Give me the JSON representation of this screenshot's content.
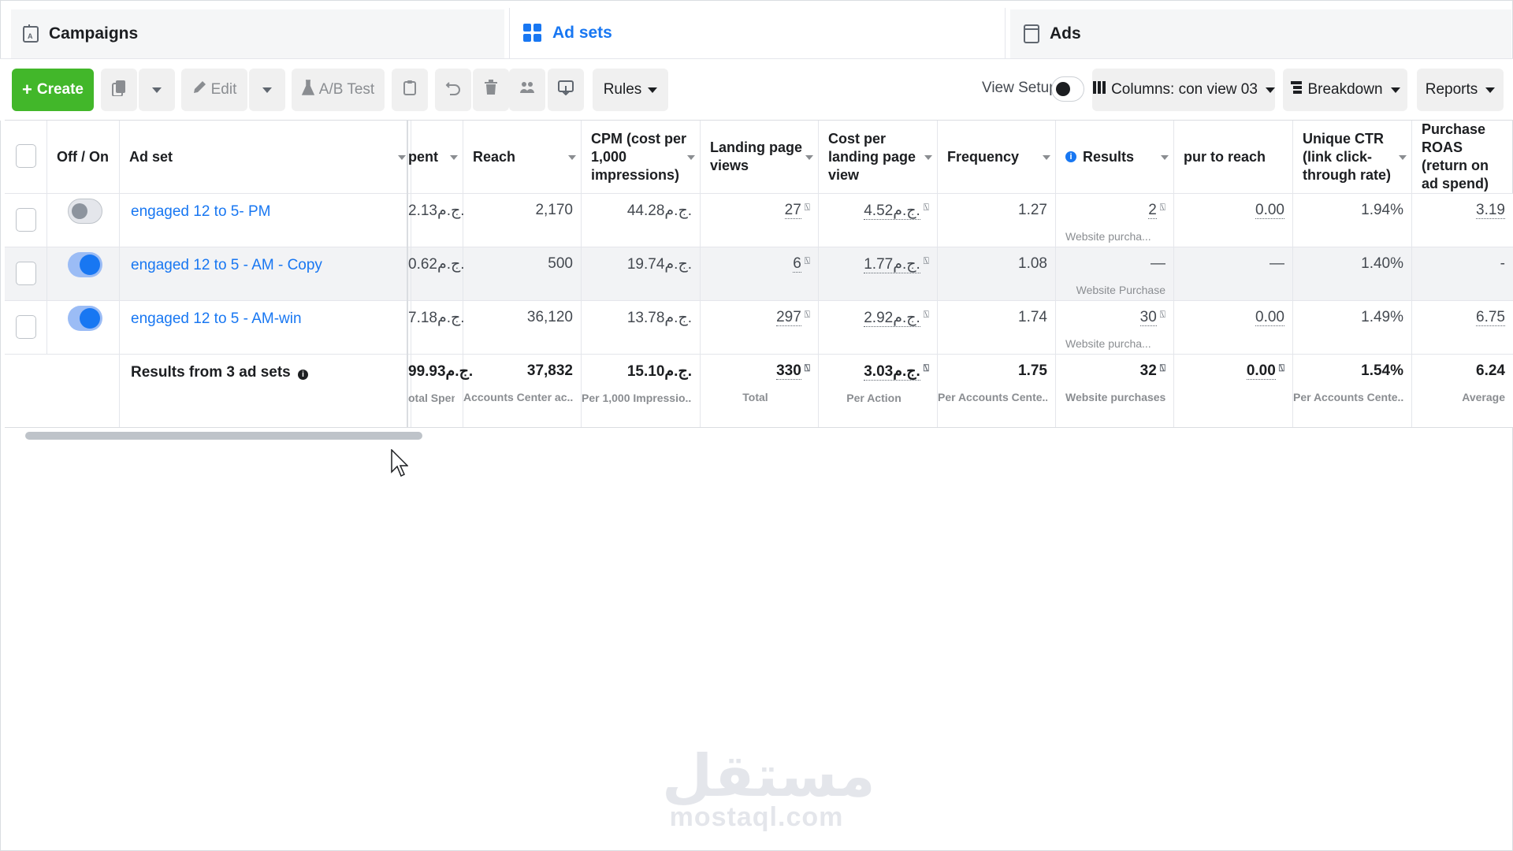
{
  "tabs": [
    {
      "label": "Campaigns",
      "icon": "campaign-flag-icon"
    },
    {
      "label": "Ad sets",
      "icon": "grid-icon",
      "active": true
    },
    {
      "label": "Ads",
      "icon": "ad-page-icon"
    }
  ],
  "toolbar": {
    "create_label": "Create",
    "edit_label": "Edit",
    "ab_test_label": "A/B Test",
    "rules_label": "Rules",
    "view_setup_label": "View Setup",
    "columns_label": "Columns: con view 03",
    "breakdown_label": "Breakdown",
    "reports_label": "Reports"
  },
  "table": {
    "headers": {
      "offon": "Off / On",
      "adset": "Ad set",
      "spent": "pent",
      "reach": "Reach",
      "cpm": "CPM (cost per 1,000 impressions)",
      "lpv": "Landing page views",
      "cplpv": "Cost per landing page view",
      "frequency": "Frequency",
      "results": "Results",
      "purreach": "pur to reach",
      "uctr": "Unique CTR (link click-through rate)",
      "roas": "Purchase ROAS (return on ad spend)"
    },
    "rows": [
      {
        "enabled": false,
        "name": "engaged 12 to 5- PM",
        "spent": "2.13ج.م.",
        "reach": "2,170",
        "cpm": "44.28ج.م.",
        "lpv": "27",
        "cplpv": "4.52ج.م.",
        "frequency": "1.27",
        "results": "2",
        "results_sub": "Website purcha...",
        "purreach": "0.00",
        "uctr": "1.94%",
        "roas": "3.19"
      },
      {
        "enabled": true,
        "name": "engaged 12 to 5 - AM - Copy",
        "spent": "0.62ج.م.",
        "reach": "500",
        "cpm": "19.74ج.م.",
        "lpv": "6",
        "cplpv": "1.77ج.م.",
        "frequency": "1.08",
        "results": "—",
        "results_sub": "Website Purchase",
        "purreach": "—",
        "uctr": "1.40%",
        "roas": "-"
      },
      {
        "enabled": true,
        "name": "engaged 12 to 5 - AM-win",
        "spent": "7.18ج.م.",
        "reach": "36,120",
        "cpm": "13.78ج.م.",
        "lpv": "297",
        "cplpv": "2.92ج.م.",
        "frequency": "1.74",
        "results": "30",
        "results_sub": "Website purcha...",
        "purreach": "0.00",
        "uctr": "1.49%",
        "roas": "6.75"
      }
    ],
    "totals": {
      "label": "Results from 3 ad sets",
      "spent": "99.93ج.م.",
      "spent_sub": "otal Spent",
      "reach": "37,832",
      "reach_sub": "Accounts Center ac...",
      "cpm": "15.10ج.م.",
      "cpm_sub": "Per 1,000 Impressio...",
      "lpv": "330",
      "lpv_sub": "Total",
      "cplpv": "3.03ج.م.",
      "cplpv_sub": "Per Action",
      "frequency": "1.75",
      "frequency_sub": "Per Accounts Cente...",
      "results": "32",
      "results_sub": "Website purchases",
      "purreach": "0.00",
      "uctr": "1.54%",
      "uctr_sub": "Per Accounts Cente...",
      "roas": "6.24",
      "roas_sub": "Average"
    }
  },
  "watermark": {
    "arabic": "مستقل",
    "latin": "mostaql.com"
  },
  "colors": {
    "accent": "#1877f2",
    "create": "#42b72a"
  }
}
